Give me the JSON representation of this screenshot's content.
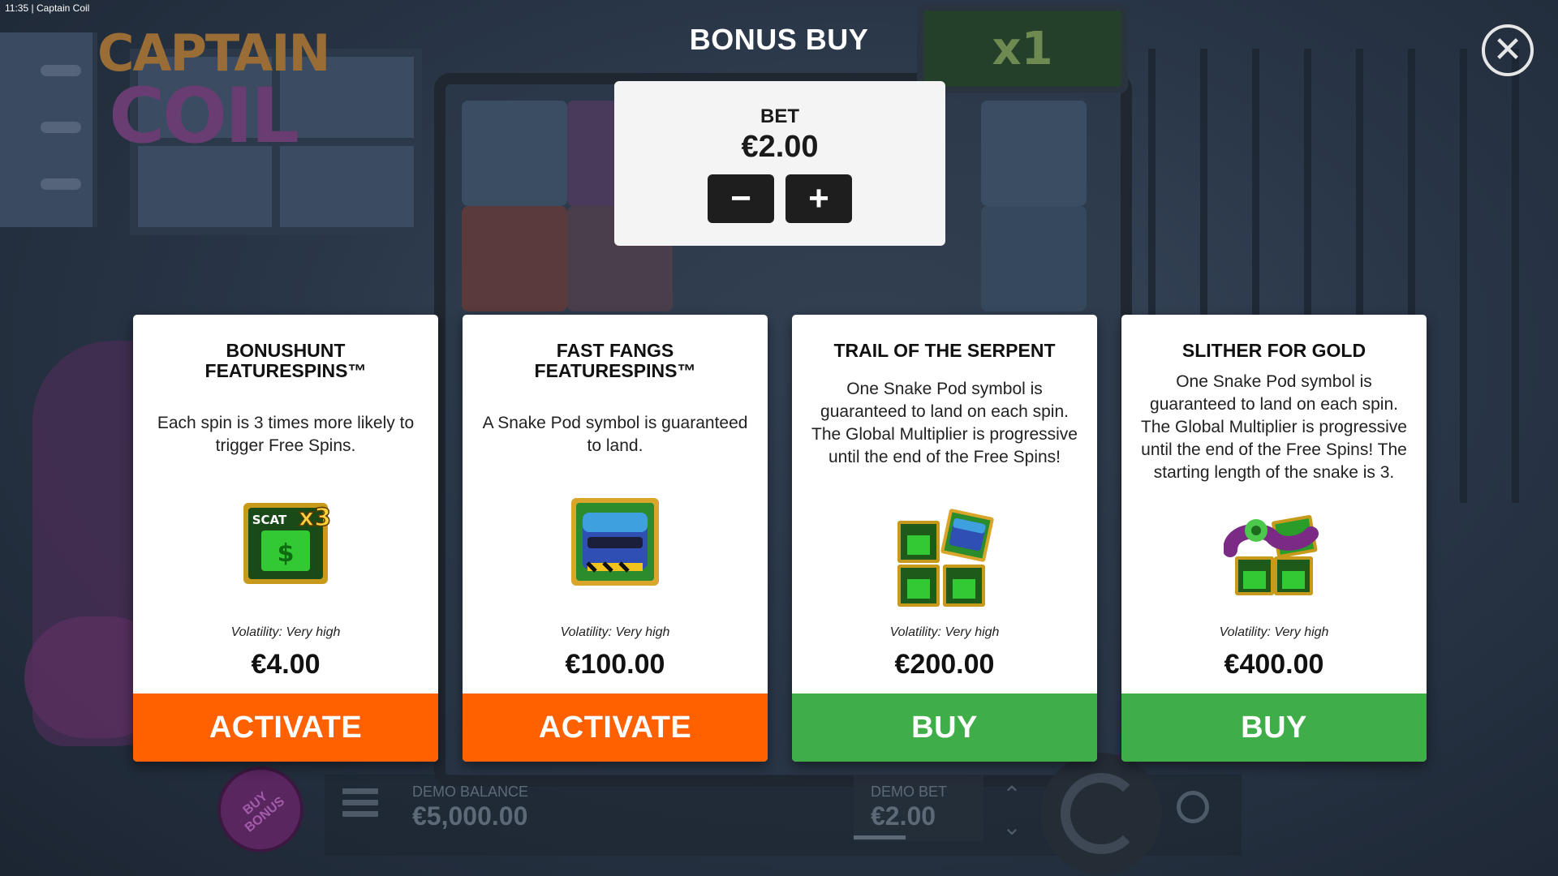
{
  "status": {
    "time": "11:35",
    "app_title": "Captain Coil"
  },
  "logo": {
    "line1": "CAPTAIN",
    "line2": "COIL"
  },
  "background": {
    "multiplier": "x1"
  },
  "header": {
    "title": "BONUS BUY",
    "close_icon": "close-icon"
  },
  "bet": {
    "label": "BET",
    "value": "€2.00",
    "decrease": "−",
    "increase": "+"
  },
  "cards": [
    {
      "title": "BONUSHUNT FEATURESPINS™",
      "description": "Each spin is 3 times more likely to trigger Free Spins.",
      "icon": "scatter-x3-icon",
      "volatility": "Volatility: Very high",
      "price": "€4.00",
      "button": "ACTIVATE",
      "button_color": "#ff6000"
    },
    {
      "title": "FAST FANGS FEATURESPINS™",
      "description": "A Snake Pod symbol is guaranteed to land.",
      "icon": "snake-pod-icon",
      "volatility": "Volatility: Very high",
      "price": "€100.00",
      "button": "ACTIVATE",
      "button_color": "#ff6000"
    },
    {
      "title": "TRAIL OF THE SERPENT",
      "description": "One Snake Pod symbol is guaranteed to land on each spin. The Global Multiplier is progressive until the end of the Free Spins!",
      "icon": "scatter-trio-with-pod-icon",
      "volatility": "Volatility: Very high",
      "price": "€200.00",
      "button": "BUY",
      "button_color": "#3fae49"
    },
    {
      "title": "SLITHER FOR GOLD",
      "description": "One Snake Pod symbol is guaranteed to land on each spin. The Global Multiplier is progressive until the end of the Free Spins! The starting length of the snake is 3.",
      "icon": "snake-on-scatters-icon",
      "volatility": "Volatility: Very high",
      "price": "€400.00",
      "button": "BUY",
      "button_color": "#3fae49"
    }
  ],
  "bottom": {
    "buy_bonus": "BUY BONUS",
    "balance_label": "DEMO BALANCE",
    "balance_value": "€5,000.00",
    "bet_label": "DEMO BET",
    "bet_value": "€2.00"
  }
}
